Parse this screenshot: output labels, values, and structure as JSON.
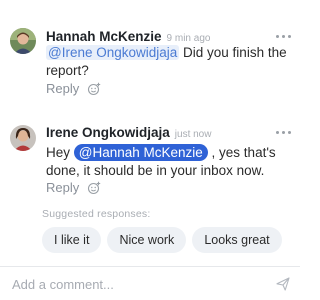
{
  "comments": [
    {
      "author": "Hannah McKenzie",
      "time": "9 min ago",
      "mention": "@Irene Ongkowidjaja",
      "text": " Did you finish the report?",
      "reply_label": "Reply",
      "avatar_icon": "avatar-hannah",
      "reaction_icon": "smile-add-icon",
      "more_icon": "more-horizontal-icon"
    },
    {
      "author": "Irene Ongkowidjaja",
      "time": "just now",
      "text_before": "Hey ",
      "mention": "@Hannah McKenzie",
      "text_after": " , yes that's done, it should be in your inbox now.",
      "reply_label": "Reply",
      "avatar_icon": "avatar-irene",
      "reaction_icon": "smile-add-icon",
      "more_icon": "more-horizontal-icon"
    }
  ],
  "suggested": {
    "title": "Suggested responses:",
    "chips": [
      "I like it",
      "Nice work",
      "Looks great"
    ]
  },
  "composer": {
    "placeholder": "Add a comment...",
    "send_icon": "send-icon"
  },
  "colors": {
    "mention_self_bg": "#2f62d6",
    "mention_other_bg": "#e8effa",
    "chip_bg": "#eef1f5"
  }
}
